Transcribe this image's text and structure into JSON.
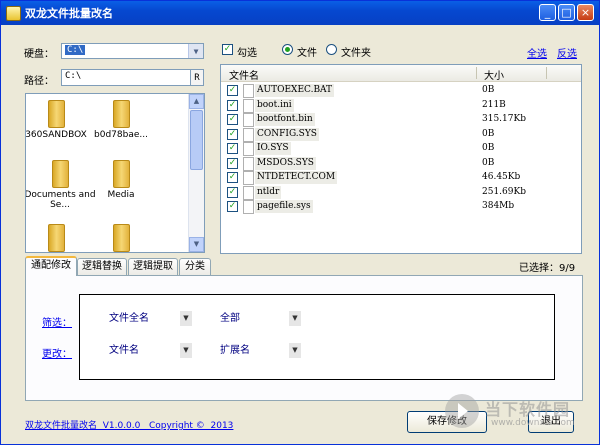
{
  "window": {
    "title": "双龙文件批量改名",
    "controls": [
      "_",
      "□",
      "×"
    ]
  },
  "left": {
    "disk_label": "硬盘：",
    "disk_value": "C:\\",
    "path_label": "路径：",
    "path_value": "C:\\",
    "path_button": "R",
    "folders": [
      "360SANDBOX",
      "b0d78bae...",
      "Documents and Se...",
      "Media",
      "",
      ""
    ]
  },
  "options": {
    "check_label": "勾选",
    "radio_file": "文件",
    "radio_folder": "文件夹",
    "select_all": "全选",
    "invert": "反选"
  },
  "filelist": {
    "col_name": "文件名",
    "col_size": "大小",
    "rows": [
      {
        "name": "AUTOEXEC.BAT",
        "size": "0B"
      },
      {
        "name": "boot.ini",
        "size": "211B"
      },
      {
        "name": "bootfont.bin",
        "size": "315.17Kb"
      },
      {
        "name": "CONFIG.SYS",
        "size": "0B"
      },
      {
        "name": "IO.SYS",
        "size": "0B"
      },
      {
        "name": "MSDOS.SYS",
        "size": "0B"
      },
      {
        "name": "NTDETECT.COM",
        "size": "46.45Kb"
      },
      {
        "name": "ntldr",
        "size": "251.69Kb"
      },
      {
        "name": "pagefile.sys",
        "size": "384Mb"
      }
    ],
    "selected_text": "已选择：9/9"
  },
  "tabs": [
    "通配修改",
    "逻辑替换",
    "逻辑提取",
    "分类"
  ],
  "panel": {
    "filter_label": "筛选：",
    "filter_field": "文件全名",
    "filter_scope": "全部",
    "modify_label": "更改：",
    "modify_field": "文件名",
    "modify_target": "扩展名"
  },
  "footer": {
    "about": "双龙文件批量改名  V1.0.0.0   Copyright ©  2013",
    "save_button": "保存修改",
    "exit_button": "退出"
  },
  "watermark": {
    "text": "当下软件园",
    "url": "www.downxia.com"
  }
}
